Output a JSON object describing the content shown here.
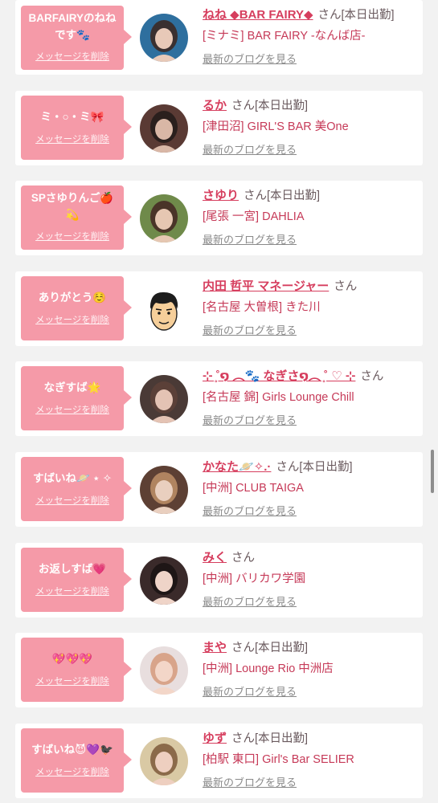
{
  "colors": {
    "accent": "#d63e5e",
    "bubble": "#f59aa8",
    "background": "#f2f2f2",
    "link_grey": "#8a8a8a"
  },
  "messages": [
    {
      "bubble_lines": [
        "BARFAIRYのねね",
        "です🐾"
      ],
      "delete_label": "メッセージを削除",
      "name": "ねね ◆BAR FAIRY◆",
      "suffix": "さん[本日出勤]",
      "shop": "[ミナミ] BAR FAIRY -なんば店-",
      "blog_label": "最新のブログを見る",
      "avatar_icon": "girl-photo-avatar"
    },
    {
      "bubble_lines": [
        "ミ・○・ミ🎀"
      ],
      "delete_label": "メッセージを削除",
      "name": "るか",
      "suffix": "さん[本日出勤]",
      "shop": "[津田沼] GIRL'S BAR 美One",
      "blog_label": "最新のブログを見る",
      "avatar_icon": "girl-photo-avatar"
    },
    {
      "bubble_lines": [
        "SPさゆりんご🍎",
        "💫"
      ],
      "delete_label": "メッセージを削除",
      "name": "さゆり",
      "suffix": "さん[本日出勤]",
      "shop": "[尾張 一宮] DAHLIA",
      "blog_label": "最新のブログを見る",
      "avatar_icon": "girl-photo-avatar"
    },
    {
      "bubble_lines": [
        "ありがとう☺️"
      ],
      "delete_label": "メッセージを削除",
      "name": "内田 哲平 マネージャー",
      "suffix": "さん",
      "shop": "[名古屋 大曽根] きた川",
      "blog_label": "最新のブログを見る",
      "avatar_icon": "manager-illustration-avatar"
    },
    {
      "bubble_lines": [
        "なぎすば🌟"
      ],
      "delete_label": "メッセージを削除",
      "name": "⊹ ̥˚໑ ︵🐾 なぎさ໑︵ ̥˚ ♡ ⊹",
      "suffix": "さん",
      "shop": "[名古屋 錦] Girls Lounge Chill",
      "blog_label": "最新のブログを見る",
      "avatar_icon": "girl-photo-avatar"
    },
    {
      "bubble_lines": [
        "すばいね🪐 ⋆ ✧"
      ],
      "delete_label": "メッセージを削除",
      "name": "かなた🪐✧.·",
      "suffix": "さん[本日出勤]",
      "shop": "[中洲] CLUB TAIGA",
      "blog_label": "最新のブログを見る",
      "avatar_icon": "girl-photo-avatar"
    },
    {
      "bubble_lines": [
        "お返しすば💗"
      ],
      "delete_label": "メッセージを削除",
      "name": "みく",
      "suffix": "さん",
      "shop": "[中洲] バリカワ学園",
      "blog_label": "最新のブログを見る",
      "avatar_icon": "girl-photo-avatar"
    },
    {
      "bubble_lines": [
        "💖💖💖"
      ],
      "delete_label": "メッセージを削除",
      "name": "まや",
      "suffix": "さん[本日出勤]",
      "shop": "[中洲] Lounge Rio 中洲店",
      "blog_label": "最新のブログを見る",
      "avatar_icon": "girl-photo-avatar"
    },
    {
      "bubble_lines": [
        "すばいね😈💜🐦‍⬛"
      ],
      "delete_label": "メッセージを削除",
      "name": "ゆず",
      "suffix": "さん[本日出勤]",
      "shop": "[柏駅 東口] Girl's Bar SELIER",
      "blog_label": "最新のブログを見る",
      "avatar_icon": "girl-photo-avatar"
    }
  ]
}
